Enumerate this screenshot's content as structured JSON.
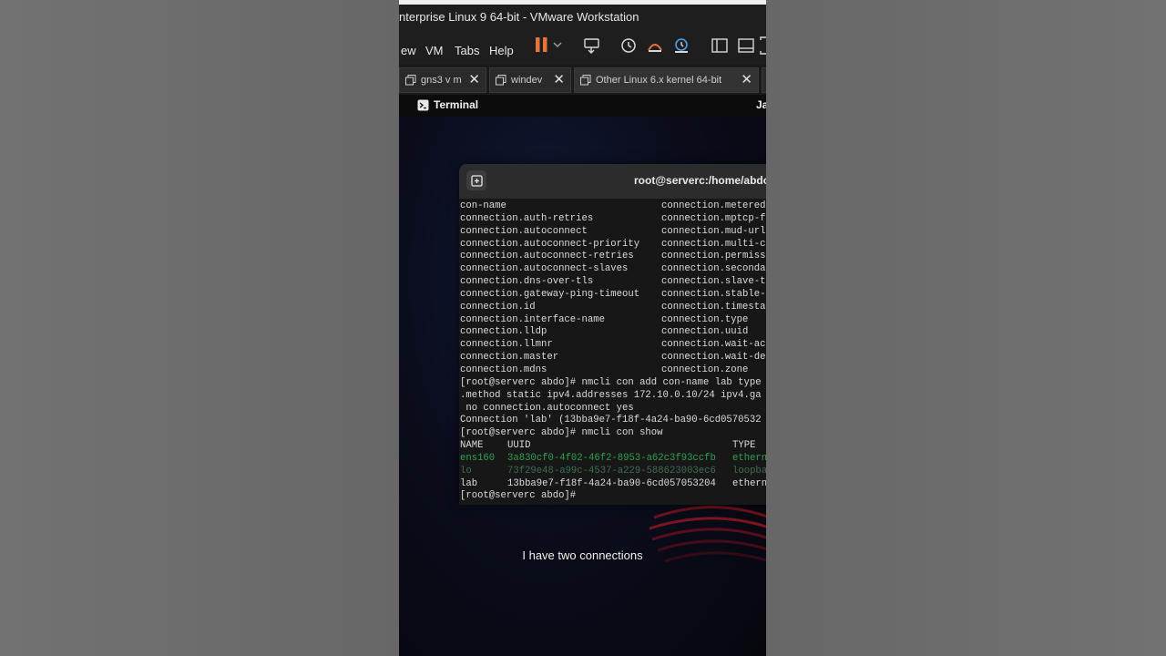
{
  "window": {
    "title": "nterprise Linux 9 64-bit - VMware Workstation"
  },
  "menu": {
    "items": [
      "ew",
      "VM",
      "Tabs",
      "Help"
    ]
  },
  "toolbar": {
    "icons": [
      "pause-icon",
      "chevron-down-icon",
      "send-keys-icon",
      "snapshot-icon",
      "revert-snapshot-icon",
      "snapshot-manager-icon",
      "sidebar-icon",
      "console-view-icon",
      "fullscreen-icon"
    ],
    "pause_color": "#e8743b"
  },
  "tabs": [
    {
      "label": "gns3 v m",
      "close": "✕"
    },
    {
      "label": "windev",
      "close": "✕"
    },
    {
      "label": "Other Linux 6.x kernel 64-bit",
      "close": "✕"
    }
  ],
  "gnome_bar": {
    "activity": "Terminal",
    "clock": "Ja"
  },
  "terminal": {
    "title": "root@serverc:/home/abdo",
    "columns": [
      [
        "con-name",
        "connection.metered"
      ],
      [
        "connection.auth-retries",
        "connection.mptcp-f"
      ],
      [
        "connection.autoconnect",
        "connection.mud-url"
      ],
      [
        "connection.autoconnect-priority",
        "connection.multi-c"
      ],
      [
        "connection.autoconnect-retries",
        "connection.permiss"
      ],
      [
        "connection.autoconnect-slaves",
        "connection.seconda"
      ],
      [
        "connection.dns-over-tls",
        "connection.slave-t"
      ],
      [
        "connection.gateway-ping-timeout",
        "connection.stable-"
      ],
      [
        "connection.id",
        "connection.timesta"
      ],
      [
        "connection.interface-name",
        "connection.type"
      ],
      [
        "connection.lldp",
        "connection.uuid"
      ],
      [
        "connection.llmnr",
        "connection.wait-ac"
      ],
      [
        "connection.master",
        "connection.wait-de"
      ],
      [
        "connection.mdns",
        "connection.zone"
      ]
    ],
    "lines": [
      "[root@serverc abdo]# nmcli con add con-name lab type",
      ".method static ipv4.addresses 172.10.0.10/24 ipv4.ga",
      " no connection.autoconnect yes",
      "Connection 'lab' (13bba9e7-f18f-4a24-ba90-6cd0570532",
      "[root@serverc abdo]# nmcli con show"
    ],
    "table_header": [
      "NAME",
      "UUID",
      "TYPE"
    ],
    "table_rows": [
      {
        "name": "ens160",
        "uuid": "3a830cf0-4f02-46f2-8953-a62c3f93ccfb",
        "type": "ethern",
        "style": "green"
      },
      {
        "name": "lo",
        "uuid": "73f29e48-a99c-4537-a229-588623003ec6",
        "type": "loopba",
        "style": "dimgreen"
      },
      {
        "name": "lab",
        "uuid": "13bba9e7-f18f-4a24-ba90-6cd057053204",
        "type": "ethern",
        "style": "plain"
      }
    ],
    "prompt": "[root@serverc abdo]#"
  },
  "subtitle": "I have two connections"
}
